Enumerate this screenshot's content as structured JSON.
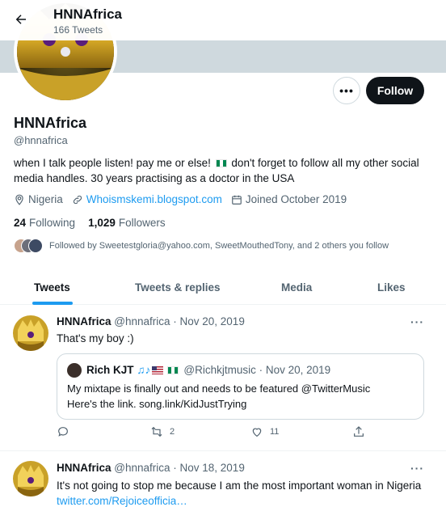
{
  "header": {
    "name": "HNNAfrica",
    "tweet_count": "166 Tweets"
  },
  "profile": {
    "name": "HNNAfrica",
    "handle": "@hnnafrica",
    "bio_before_flag": "when I talk people listen! pay me or else!",
    "bio_after_flag": "don't forget to follow all my other social media handles. 30 years practising as a doctor in the USA",
    "location": "Nigeria",
    "website": "Whoismskemi.blogspot.com",
    "joined": "Joined October 2019",
    "following_count": "24",
    "following_label": "Following",
    "followers_count": "1,029",
    "followers_label": "Followers",
    "followed_by": "Followed by Sweetestgloria@yahoo.com, SweetMouthedTony, and 2 others you follow"
  },
  "actions": {
    "more_label": "•••",
    "follow_label": "Follow"
  },
  "tabs": [
    "Tweets",
    "Tweets & replies",
    "Media",
    "Likes"
  ],
  "tweets": [
    {
      "author": "HNNAfrica",
      "handle_date": "@hnnafrica · Nov 20, 2019",
      "text": "That's my boy :)",
      "quote": {
        "author": "Rich KJT",
        "handle_date": "@Richkjtmusic · Nov 20, 2019",
        "line1": "My mixtape is finally out and needs to be featured @TwitterMusic",
        "line2": "Here's the link. song.link/KidJustTrying"
      },
      "retweets": "2",
      "likes": "11"
    },
    {
      "author": "HNNAfrica",
      "handle_date": "@hnnafrica · Nov 18, 2019",
      "text": "It's not going to stop me because I am the most important woman in Nigeria",
      "link": "twitter.com/Rejoiceofficia…"
    }
  ],
  "colors": {
    "accent": "#1d9bf0",
    "text": "#0f1419",
    "muted": "#536471",
    "follow_button": "#0f1419"
  }
}
